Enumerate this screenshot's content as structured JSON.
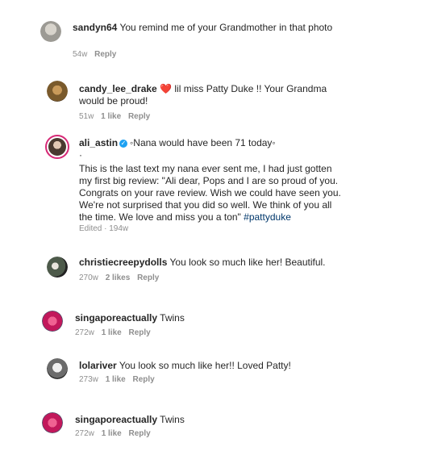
{
  "comments": [
    {
      "username": "sandyn64",
      "text": "You remind me of your Grandmother in that photo",
      "time": "54w",
      "reply": "Reply",
      "avatar_color": "#9c9a94"
    },
    {
      "username": "candy_lee_drake",
      "heart": "❤️",
      "text": "lil miss Patty Duke !! Your Grandma would be proud!",
      "time": "51w",
      "likes": "1 like",
      "reply": "Reply",
      "avatar_color": "#7a5a2c"
    },
    {
      "username": "ali_astin",
      "verified": "✓",
      "headline": "◦Nana would have been 71 today◦",
      "dot": "·",
      "body": "This is the last text my nana ever sent me, I had just gotten my first big review: \"Ali dear, Pops and I are so proud of you. Congrats on your rave review. Wish we could have seen you. We're not surprised that you did so well. We think of you all the time. We love and miss you a ton\"",
      "hashtag": "#pattyduke",
      "time": "Edited · 194w",
      "avatar_color": "#4a3a30",
      "ring_color": "#d62976"
    },
    {
      "username": "christiecreepydolls",
      "text": "You look so much like her! Beautiful.",
      "time": "270w",
      "likes": "2 likes",
      "reply": "Reply",
      "avatar_color": "#4d5a4a"
    },
    {
      "username": "singaporeactually",
      "text": "Twins",
      "time": "272w",
      "likes": "1 like",
      "reply": "Reply",
      "avatar_color": "#c2185b"
    },
    {
      "username": "lolariver",
      "text": "You look so much like her!! Loved Patty!",
      "time": "273w",
      "likes": "1 like",
      "reply": "Reply",
      "avatar_color": "#6b6b6b"
    },
    {
      "username": "singaporeactually",
      "text": "Twins",
      "time": "272w",
      "likes": "1 like",
      "reply": "Reply",
      "avatar_color": "#c2185b"
    }
  ]
}
